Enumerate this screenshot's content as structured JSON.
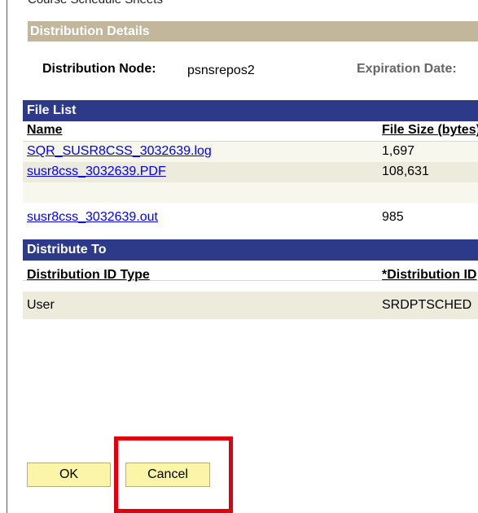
{
  "page": {
    "top_title": "Course Schedule Sheets"
  },
  "distribution_details": {
    "header": "Distribution Details",
    "node_label": "Distribution Node:",
    "node_value": "psnsrepos2",
    "expiration_label": "Expiration Date:"
  },
  "file_list": {
    "header": "File List",
    "columns": {
      "name": "Name",
      "size": "File Size (bytes)"
    },
    "rows": [
      {
        "name": "SQR_SUSR8CSS_3032639.log",
        "size": "1,697"
      },
      {
        "name": "susr8css_3032639.PDF",
        "size": "108,631"
      },
      {
        "name": "susr8css_3032639.out",
        "size": "985"
      }
    ]
  },
  "distribute_to": {
    "header": "Distribute To",
    "columns": {
      "id_type": "Distribution ID Type",
      "distribution_id": "*Distribution ID"
    },
    "rows": [
      {
        "id_type": "User",
        "distribution_id": "SRDPTSCHED"
      }
    ]
  },
  "buttons": {
    "ok": "OK",
    "cancel": "Cancel"
  },
  "colors": {
    "section_bar_blue": "#2d3a8a",
    "section_bar_tan": "#c2b79b",
    "button_fill": "#fbf5a7",
    "highlight": "#e2000f",
    "link": "#0000ee"
  }
}
